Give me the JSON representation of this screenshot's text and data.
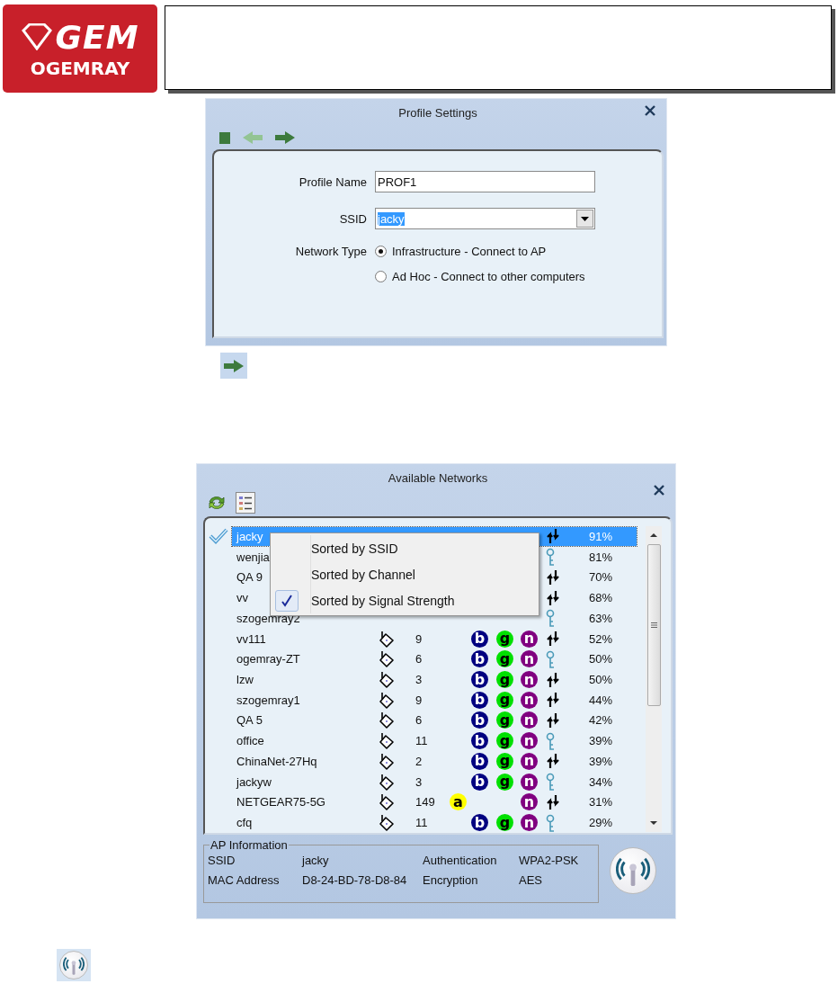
{
  "header": {
    "logo_mark": "GEM",
    "logo_name": "OGEMRAY"
  },
  "profile_window": {
    "title": "Profile Settings",
    "fields": [
      {
        "label": "Profile Name",
        "kind": "text",
        "value": "PROF1",
        "value_selected": false
      },
      {
        "label": "SSID",
        "kind": "combo",
        "value": "jacky",
        "value_selected": true
      }
    ],
    "network_type": {
      "label": "Network Type",
      "options": [
        {
          "label": "Infrastructure - Connect to AP",
          "selected": true
        },
        {
          "label": "Ad Hoc - Connect to other computers",
          "selected": false
        }
      ]
    }
  },
  "networks_window": {
    "title": "Available Networks",
    "rows": [
      {
        "ssid": "jacky",
        "selected": true,
        "connected": true,
        "modes": [],
        "key_icon": false,
        "signal": "91%"
      },
      {
        "ssid": "wenjia",
        "selected": false,
        "connected": false,
        "modes": [],
        "key_icon": true,
        "signal": "81%"
      },
      {
        "ssid": "QA 9",
        "selected": false,
        "connected": false,
        "modes": [],
        "key_icon": false,
        "signal": "70%"
      },
      {
        "ssid": "vv",
        "selected": false,
        "connected": false,
        "modes": [],
        "key_icon": false,
        "signal": "68%"
      },
      {
        "ssid": "szogemray2",
        "selected": false,
        "connected": false,
        "modes": [],
        "key_icon": true,
        "signal": "63%"
      },
      {
        "ssid": "vv111",
        "selected": false,
        "connected": false,
        "channel": "9",
        "modes": [
          {
            "kind": "b",
            "label": "b",
            "color": "#000080"
          },
          {
            "kind": "g",
            "label": "g",
            "color": "#00e000"
          },
          {
            "kind": "n",
            "label": "n",
            "color": "#800080"
          }
        ],
        "key_icon": false,
        "signal": "52%"
      },
      {
        "ssid": "ogemray-ZT",
        "selected": false,
        "connected": false,
        "channel": "6",
        "modes": [
          {
            "kind": "b",
            "label": "b",
            "color": "#000080"
          },
          {
            "kind": "g",
            "label": "g",
            "color": "#00e000"
          },
          {
            "kind": "n",
            "label": "n",
            "color": "#800080"
          }
        ],
        "key_icon": true,
        "signal": "50%"
      },
      {
        "ssid": "lzw",
        "selected": false,
        "connected": false,
        "channel": "3",
        "modes": [
          {
            "kind": "b",
            "label": "b",
            "color": "#000080"
          },
          {
            "kind": "g",
            "label": "g",
            "color": "#00e000"
          },
          {
            "kind": "n",
            "label": "n",
            "color": "#800080"
          }
        ],
        "key_icon": false,
        "signal": "50%"
      },
      {
        "ssid": "szogemray1",
        "selected": false,
        "connected": false,
        "channel": "9",
        "modes": [
          {
            "kind": "b",
            "label": "b",
            "color": "#000080"
          },
          {
            "kind": "g",
            "label": "g",
            "color": "#00e000"
          },
          {
            "kind": "n",
            "label": "n",
            "color": "#800080"
          }
        ],
        "key_icon": false,
        "signal": "44%"
      },
      {
        "ssid": "QA 5",
        "selected": false,
        "connected": false,
        "channel": "6",
        "modes": [
          {
            "kind": "b",
            "label": "b",
            "color": "#000080"
          },
          {
            "kind": "g",
            "label": "g",
            "color": "#00e000"
          },
          {
            "kind": "n",
            "label": "n",
            "color": "#800080"
          }
        ],
        "key_icon": false,
        "signal": "42%"
      },
      {
        "ssid": "office",
        "selected": false,
        "connected": false,
        "channel": "11",
        "modes": [
          {
            "kind": "b",
            "label": "b",
            "color": "#000080"
          },
          {
            "kind": "g",
            "label": "g",
            "color": "#00e000"
          },
          {
            "kind": "n",
            "label": "n",
            "color": "#800080"
          }
        ],
        "key_icon": true,
        "signal": "39%"
      },
      {
        "ssid": "ChinaNet-27Hq",
        "selected": false,
        "connected": false,
        "channel": "2",
        "modes": [
          {
            "kind": "b",
            "label": "b",
            "color": "#000080"
          },
          {
            "kind": "g",
            "label": "g",
            "color": "#00e000"
          },
          {
            "kind": "n",
            "label": "n",
            "color": "#800080"
          }
        ],
        "key_icon": false,
        "signal": "39%"
      },
      {
        "ssid": "jackyw",
        "selected": false,
        "connected": false,
        "channel": "3",
        "modes": [
          {
            "kind": "b",
            "label": "b",
            "color": "#000080"
          },
          {
            "kind": "g",
            "label": "g",
            "color": "#00e000"
          },
          {
            "kind": "n",
            "label": "n",
            "color": "#800080"
          }
        ],
        "key_icon": true,
        "signal": "34%"
      },
      {
        "ssid": "NETGEAR75-5G",
        "selected": false,
        "connected": false,
        "channel": "149",
        "modes": [
          {
            "kind": "a",
            "label": "a",
            "color": "#ffff00"
          },
          {
            "kind": "n",
            "label": "n",
            "color": "#800080"
          }
        ],
        "key_icon": false,
        "signal": "31%"
      },
      {
        "ssid": "cfq",
        "selected": false,
        "connected": false,
        "channel": "11",
        "modes": [
          {
            "kind": "b",
            "label": "b",
            "color": "#000080"
          },
          {
            "kind": "g",
            "label": "g",
            "color": "#00e000"
          },
          {
            "kind": "n",
            "label": "n",
            "color": "#800080"
          }
        ],
        "key_icon": true,
        "signal": "29%"
      }
    ],
    "sort_menu": [
      {
        "label": "Sorted by SSID",
        "checked": false
      },
      {
        "label": "Sorted by Channel",
        "checked": false
      },
      {
        "label": "Sorted by Signal Strength",
        "checked": true
      }
    ],
    "ap_info": {
      "title": "AP Information",
      "items": [
        {
          "label": "SSID",
          "value": "jacky"
        },
        {
          "label": "Authentication",
          "value": "WPA2-PSK"
        },
        {
          "label": "MAC Address",
          "value": "D8-24-BD-78-D8-84"
        },
        {
          "label": "Encryption",
          "value": "AES"
        }
      ]
    }
  }
}
